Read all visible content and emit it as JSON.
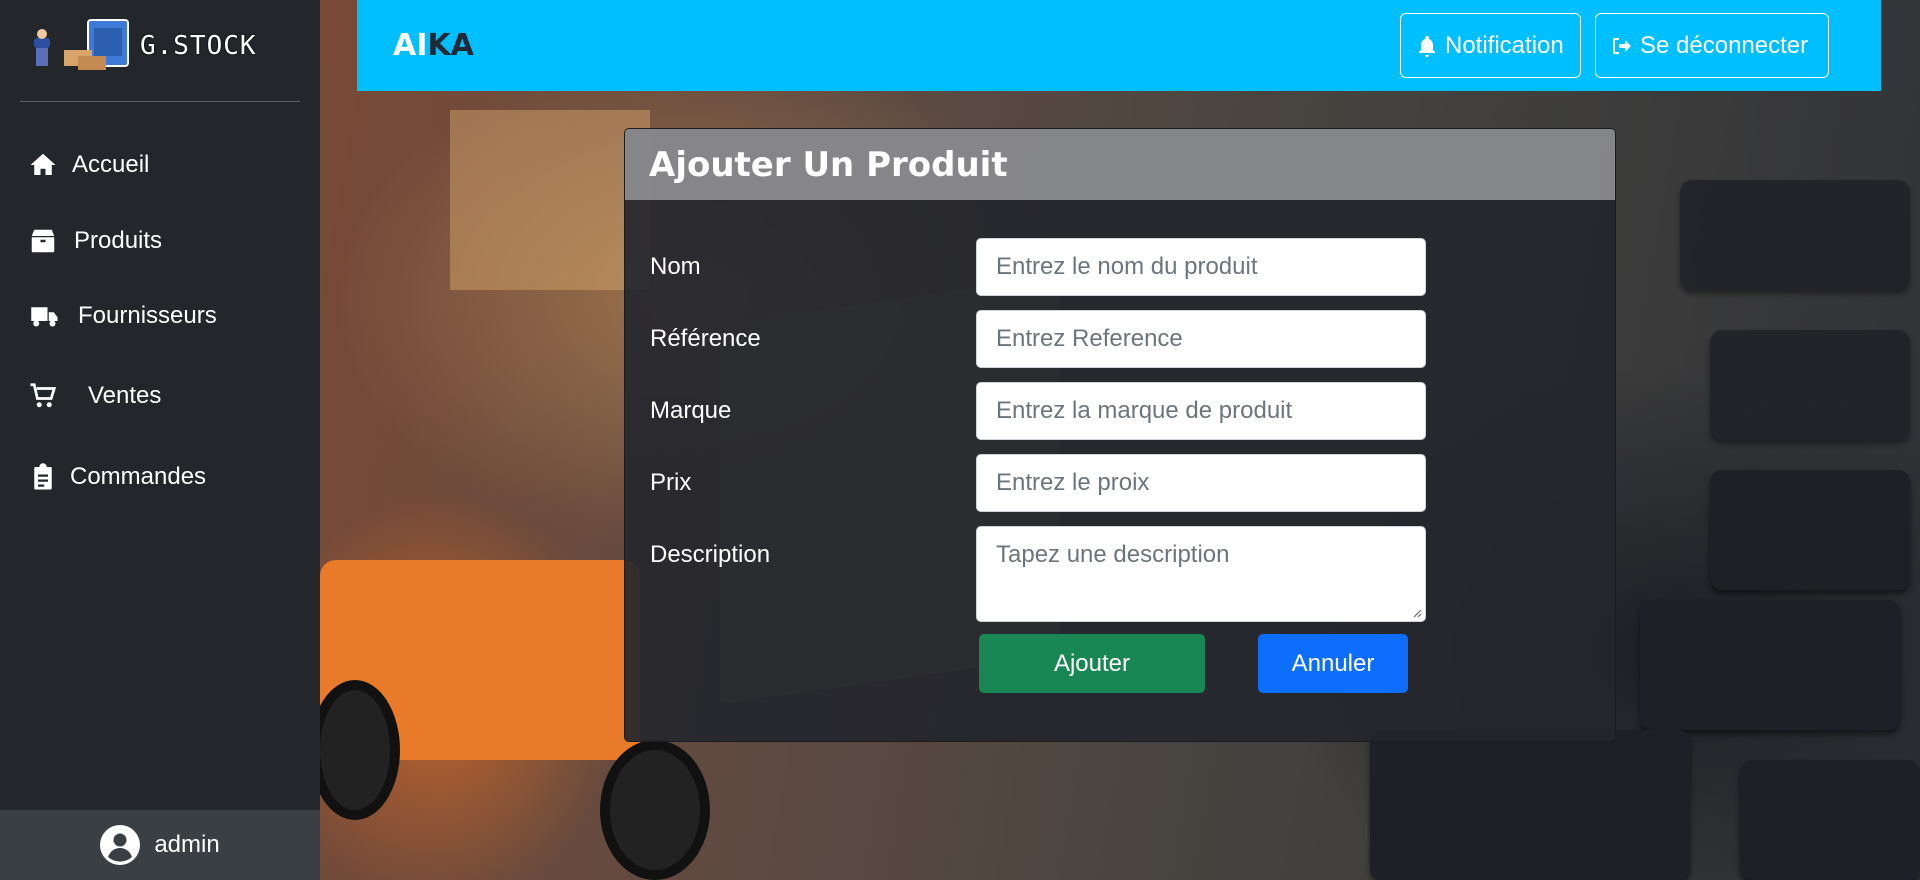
{
  "sidebar": {
    "brand": "G.STOCK",
    "items": [
      {
        "label": "Accueil",
        "icon": "home-icon"
      },
      {
        "label": "Produits",
        "icon": "box-icon"
      },
      {
        "label": "Fournisseurs",
        "icon": "truck-icon"
      },
      {
        "label": "Ventes",
        "icon": "cart-icon"
      },
      {
        "label": "Commandes",
        "icon": "clipboard-icon"
      }
    ],
    "user": "admin"
  },
  "header": {
    "title_part1": "AI",
    "title_part2": "KA",
    "notification_label": "Notification",
    "logout_label": "Se déconnecter"
  },
  "form": {
    "title": "Ajouter Un Produit",
    "fields": [
      {
        "label": "Nom",
        "placeholder": "Entrez le nom du produit"
      },
      {
        "label": "Référence",
        "placeholder": "Entrez Reference"
      },
      {
        "label": "Marque",
        "placeholder": "Entrez la marque de produit"
      },
      {
        "label": "Prix",
        "placeholder": "Entrez le proix"
      },
      {
        "label": "Description",
        "placeholder": "Tapez une description"
      }
    ],
    "submit_label": "Ajouter",
    "cancel_label": "Annuler"
  },
  "colors": {
    "header_bg": "#00bfff",
    "sidebar_bg": "#23272b",
    "submit_bg": "#198754",
    "cancel_bg": "#0d6efd"
  }
}
